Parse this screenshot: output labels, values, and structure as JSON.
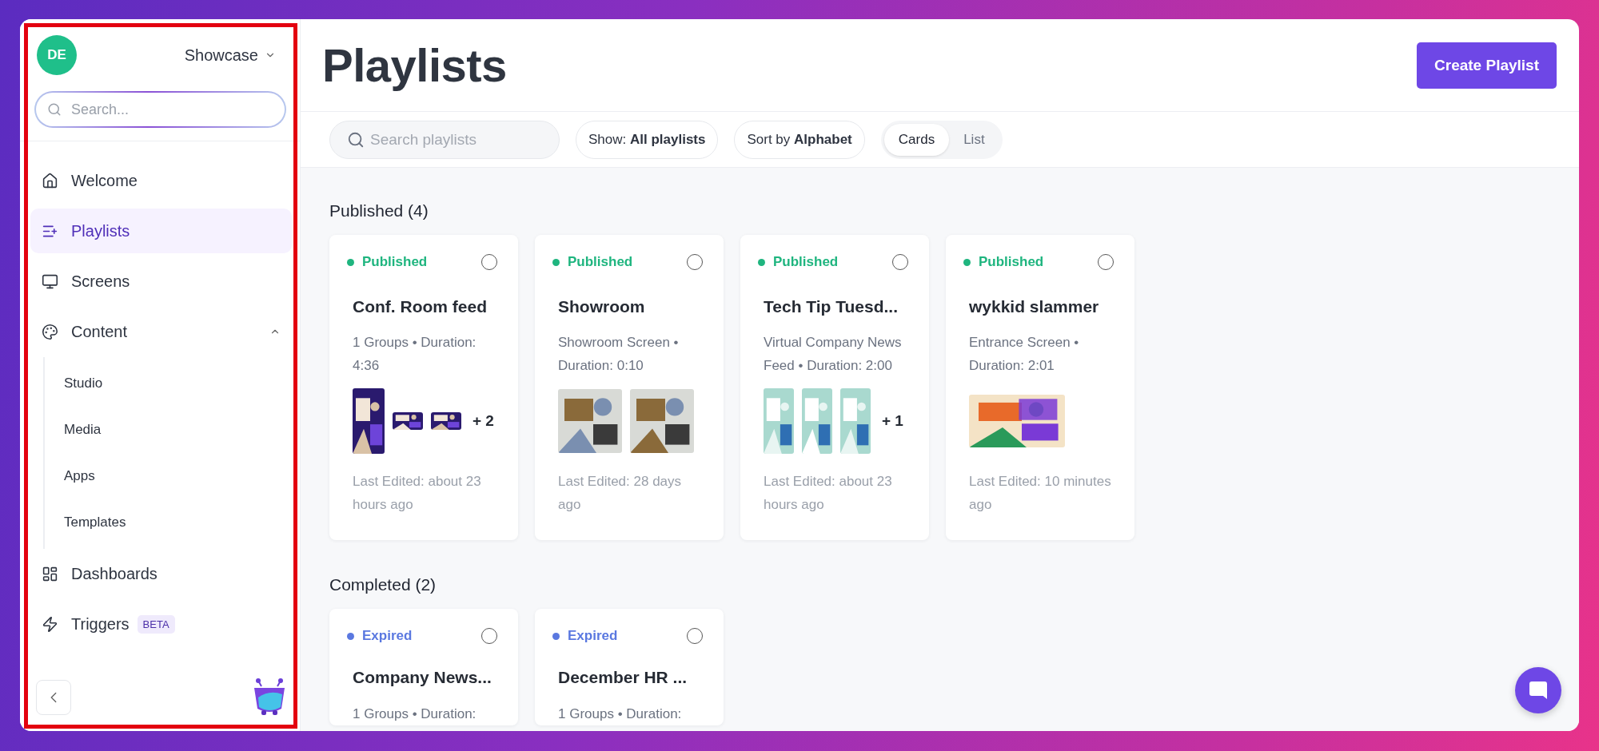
{
  "sidebar": {
    "avatar": "DE",
    "workspace": "Showcase",
    "search": {
      "placeholder": "Search..."
    },
    "items": [
      {
        "label": "Welcome",
        "kind": "home",
        "selected": false
      },
      {
        "label": "Playlists",
        "kind": "playlist",
        "selected": true
      },
      {
        "label": "Screens",
        "kind": "monitor",
        "selected": false
      },
      {
        "label": "Content",
        "kind": "palette",
        "selected": false,
        "expanded": true,
        "children": [
          {
            "label": "Studio",
            "selected": false
          },
          {
            "label": "Media",
            "selected": false
          },
          {
            "label": "Apps",
            "selected": false
          },
          {
            "label": "Templates",
            "selected": false
          }
        ]
      },
      {
        "label": "Dashboards",
        "kind": "dashboard",
        "selected": false
      },
      {
        "label": "Triggers",
        "kind": "bolt",
        "selected": false,
        "badge": "BETA"
      }
    ]
  },
  "header": {
    "title": "Playlists",
    "button": "Create Playlist"
  },
  "toolbar": {
    "search": {
      "placeholder": "Search playlists"
    },
    "filter": "Show: **All playlists**",
    "sort": "Sort by **Alphabet**",
    "views": [
      {
        "label": "Cards",
        "selected": true
      },
      {
        "label": "List",
        "selected": false
      }
    ]
  },
  "sections": [
    {
      "title": "Published (4)",
      "cards": [
        {
          "status": "Published",
          "color": "#1fb57f",
          "checked": false,
          "title": "Conf. Room feed",
          "meta": "1 Groups • Duration: 4:36",
          "more": "+ 2",
          "edited": "Last Edited: about 23 hours ago"
        },
        {
          "status": "Published",
          "color": "#1fb57f",
          "checked": false,
          "title": "Showroom",
          "meta": "Showroom Screen • Duration: 0:10",
          "edited": "Last Edited: 28 days ago"
        },
        {
          "status": "Published",
          "color": "#1fb57f",
          "checked": false,
          "title": "Tech Tip Tuesd...",
          "meta": "Virtual Company News Feed • Duration: 2:00",
          "more": "+ 1",
          "edited": "Last Edited: about 23 hours ago"
        },
        {
          "status": "Published",
          "color": "#1fb57f",
          "checked": false,
          "title": "wykkid slammer",
          "meta": "Entrance Screen • Duration: 2:01",
          "edited": "Last Edited: 10 minutes ago"
        }
      ]
    },
    {
      "title": "Completed (2)",
      "cards": [
        {
          "status": "Expired",
          "color": "#5a78e0",
          "checked": false,
          "title": "Company News...",
          "meta": "1 Groups • Duration:"
        },
        {
          "status": "Expired",
          "color": "#5a78e0",
          "checked": false,
          "title": "December HR ...",
          "meta": "1 Groups • Duration:"
        }
      ]
    }
  ]
}
